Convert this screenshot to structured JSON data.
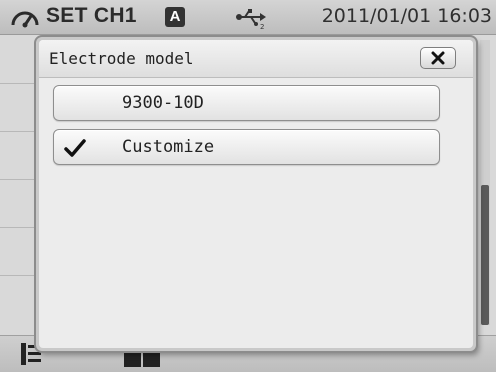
{
  "status_bar": {
    "title": "SET CH1",
    "mode_badge": "A",
    "datetime": "2011/01/01 16:03",
    "icons": [
      "gauge-icon",
      "usb-icon"
    ]
  },
  "dialog": {
    "title": "Electrode model",
    "close_icon": "close-icon",
    "options": [
      {
        "label": "9300-10D",
        "selected": false
      },
      {
        "label": "Customize",
        "selected": true
      }
    ],
    "check_icon": "checkmark-icon"
  },
  "bottom_bar": {
    "icons": [
      "list-icon",
      "book-icon"
    ]
  }
}
